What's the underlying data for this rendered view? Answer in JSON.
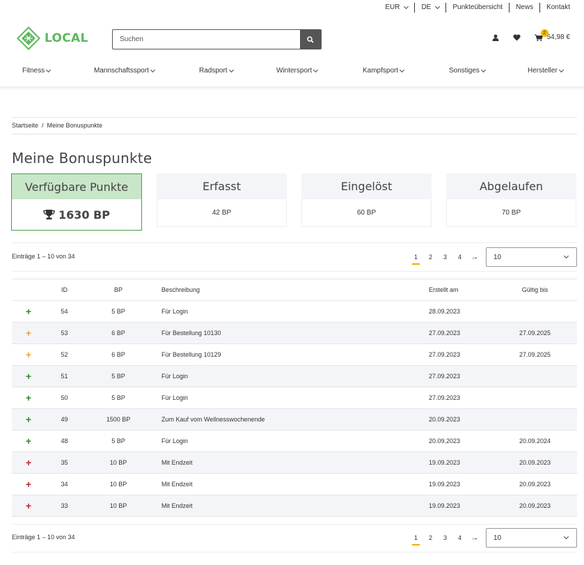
{
  "topbar": {
    "currency": "EUR",
    "language": "DE",
    "points_overview": "Punkteübersicht",
    "news": "News",
    "contact": "Kontakt"
  },
  "header": {
    "logo_text": "LOCAL",
    "search_placeholder": "Suchen",
    "cart_count": "2",
    "cart_total": "54,98 €"
  },
  "nav": [
    "Fitness",
    "Mannschaftssport",
    "Radsport",
    "Wintersport",
    "Kampfsport",
    "Sonstiges",
    "Hersteller"
  ],
  "breadcrumb": {
    "home": "Startseite",
    "separator": "/",
    "current": "Meine Bonuspunkte"
  },
  "page_title": "Meine Bonuspunkte",
  "cards": {
    "available": {
      "label": "Verfügbare Punkte",
      "value": "1630 BP"
    },
    "earned": {
      "label": "Erfasst",
      "value": "42 BP"
    },
    "redeemed": {
      "label": "Eingelöst",
      "value": "60 BP"
    },
    "expired": {
      "label": "Abgelaufen",
      "value": "70 BP"
    }
  },
  "pagination": {
    "entries_text": "Einträge 1 – 10 von 34",
    "pages": [
      "1",
      "2",
      "3",
      "4"
    ],
    "current_page": "1",
    "next_arrow": "→",
    "per_page": "10"
  },
  "table": {
    "headers": {
      "id": "ID",
      "bp": "BP",
      "description": "Beschreibung",
      "created": "Erstellt am",
      "valid": "Gültig bis"
    },
    "rows": [
      {
        "sign": "+",
        "status": "earned",
        "id": "54",
        "bp": "5 BP",
        "description": "Für Login",
        "created": "28.09.2023",
        "valid": ""
      },
      {
        "sign": "+",
        "status": "pending",
        "id": "53",
        "bp": "6 BP",
        "description": "Für Bestellung 10130",
        "created": "27.09.2023",
        "valid": "27.09.2025"
      },
      {
        "sign": "+",
        "status": "pending",
        "id": "52",
        "bp": "6 BP",
        "description": "Für Bestellung 10129",
        "created": "27.09.2023",
        "valid": "27.09.2025"
      },
      {
        "sign": "+",
        "status": "earned",
        "id": "51",
        "bp": "5 BP",
        "description": "Für Login",
        "created": "27.09.2023",
        "valid": ""
      },
      {
        "sign": "+",
        "status": "earned",
        "id": "50",
        "bp": "5 BP",
        "description": "Für Login",
        "created": "27.09.2023",
        "valid": ""
      },
      {
        "sign": "+",
        "status": "earned",
        "id": "49",
        "bp": "1500 BP",
        "description": "Zum Kauf vom Wellnesswochenende",
        "created": "20.09.2023",
        "valid": ""
      },
      {
        "sign": "+",
        "status": "earned",
        "id": "48",
        "bp": "5 BP",
        "description": "Für Login",
        "created": "20.09.2023",
        "valid": "20.09.2024"
      },
      {
        "sign": "+",
        "status": "expired",
        "id": "35",
        "bp": "10 BP",
        "description": "Mit Endzeit",
        "created": "19.09.2023",
        "valid": "20.09.2023"
      },
      {
        "sign": "+",
        "status": "expired",
        "id": "34",
        "bp": "10 BP",
        "description": "Mit Endzeit",
        "created": "19.09.2023",
        "valid": "20.09.2023"
      },
      {
        "sign": "+",
        "status": "expired",
        "id": "33",
        "bp": "10 BP",
        "description": "Mit Endzeit",
        "created": "19.09.2023",
        "valid": "20.09.2023"
      }
    ]
  },
  "colors": {
    "brand": "#5cb85c",
    "earned": "#2e8b2e",
    "pending": "#f0a040",
    "expired": "#c0262c",
    "active_card": "#c8e6c8",
    "accent": "#f5a800"
  },
  "icons": [
    "logo-icon",
    "search-icon",
    "user-icon",
    "heart-icon",
    "cart-icon",
    "trophy-icon",
    "chevron-down-icon"
  ]
}
